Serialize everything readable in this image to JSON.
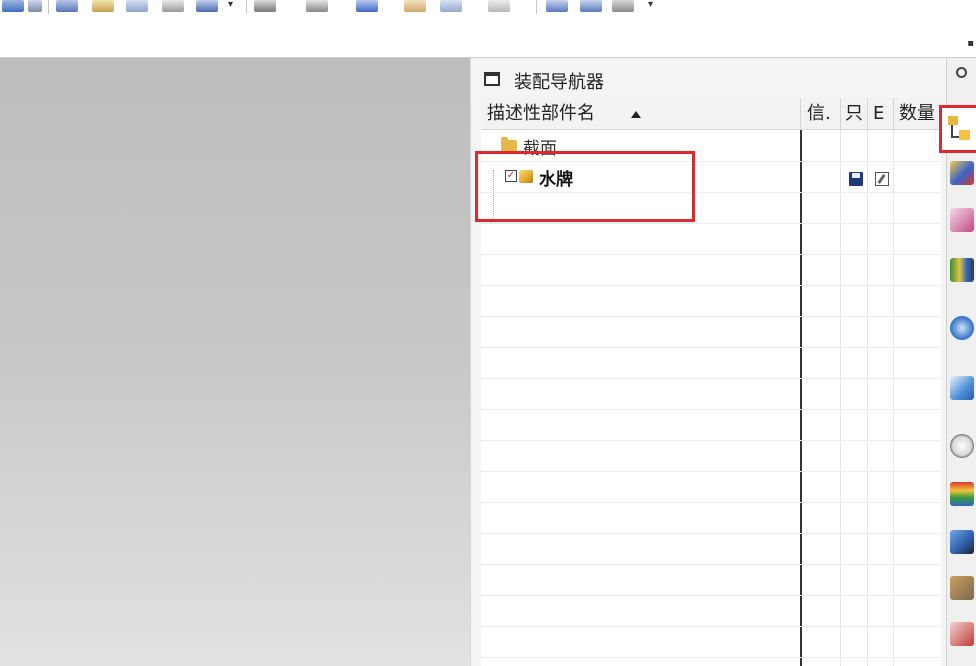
{
  "navigator": {
    "title": "装配导航器",
    "columns": {
      "name": "描述性部件名",
      "info": "信.",
      "readonly": "只",
      "modified": "E",
      "quantity": "数量"
    },
    "rows": [
      {
        "label": "截面",
        "type": "section-folder"
      },
      {
        "label": "水牌",
        "type": "part",
        "checked": true
      }
    ]
  },
  "colors": {
    "highlight": "#e0282f",
    "viewport_top": "#bdbdbd",
    "viewport_bottom": "#e2e2e2"
  },
  "icons": {
    "toolbar": [
      "model-icon",
      "sketch-icon",
      "extrude-icon",
      "revolve-icon",
      "shell-icon",
      "drawing-icon",
      "measure-icon",
      "block-icon",
      "note-icon",
      "view-icon",
      "blank-icon",
      "move-icon",
      "edit-icon",
      "transform-icon"
    ],
    "resource_bar": [
      "settings-icon",
      "assembly-navigator-icon",
      "constraint-navigator-icon",
      "part-navigator-icon",
      "reuse-library-icon",
      "hd3d-tools-icon",
      "web-browser-icon",
      "history-icon",
      "system-materials-icon",
      "process-studio-icon",
      "roles-icon",
      "manufacturing-wizard-icon"
    ]
  }
}
